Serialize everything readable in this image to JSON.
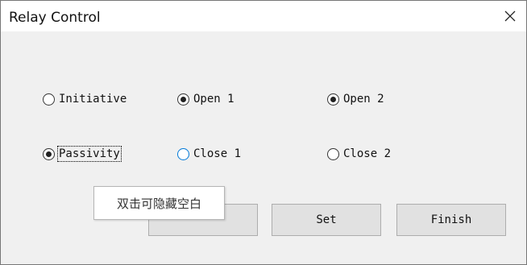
{
  "window": {
    "title": "Relay Control"
  },
  "radios": {
    "initiative": {
      "label": "Initiative",
      "checked": false
    },
    "open1": {
      "label": "Open 1",
      "checked": true
    },
    "open2": {
      "label": "Open 2",
      "checked": true
    },
    "passivity": {
      "label": "Passivity",
      "checked": true
    },
    "close1": {
      "label": "Close 1",
      "checked": false
    },
    "close2": {
      "label": "Close 2",
      "checked": false
    }
  },
  "buttons": {
    "hidden_label": "",
    "set_label": "Set",
    "finish_label": "Finish"
  },
  "tooltip": {
    "text": "双击可隐藏空白"
  },
  "colors": {
    "accent": "#0078d7",
    "window_bg": "#f0f0f0",
    "button_bg": "#e1e1e1"
  }
}
